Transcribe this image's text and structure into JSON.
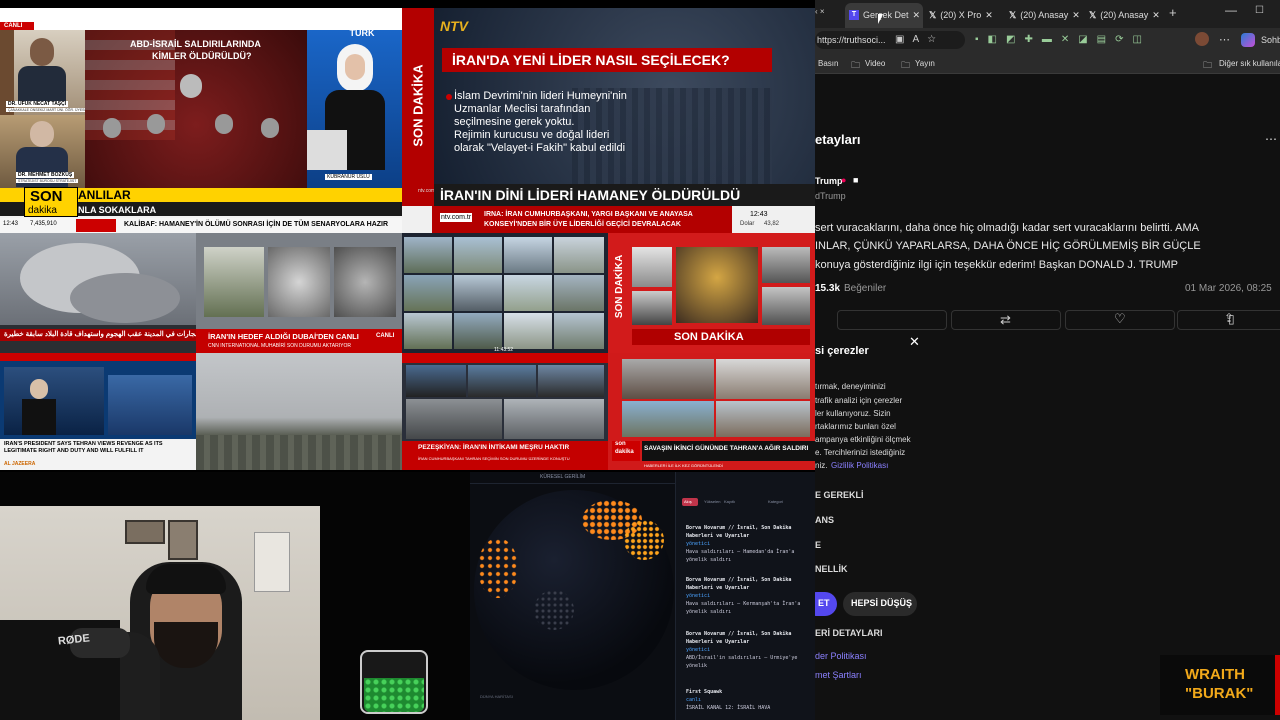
{
  "haberturk": {
    "live_badge": "CANLI",
    "headline_l1": "ABD-İSRAİL SALDIRILARINDA",
    "headline_l2": "KİMLER ÖLDÜRÜLDÜ?",
    "guest1_name": "DR. UFUK NECAT TAŞÇI",
    "guest1_title": "ÇANAKKALE ONSEKİZ MART ÜNİ. ÖĞR. ÜYESİ",
    "guest2_name": "DR. MEHMET BOZKUŞ",
    "guest2_title": "STRATEJİST BÜROSU STRATEJİST",
    "anchor_name": "KÜBRANUR USLU",
    "logo": "HABER TÜRK",
    "son": "SON",
    "dakika": "dakika",
    "banner1": "ANLILAR",
    "banner2": "NLA SOKAKLARA",
    "ticker_time": "12:43",
    "ticker_num": "7,435,910",
    "ticker_text": "KALİBAF: HAMANEY'İN ÖLÜMÜ SONRASI İÇİN DE TÜM SENARYOLARA HAZIR"
  },
  "ntv": {
    "logo": "NTV",
    "side": "SON DAKİKA",
    "headline": "İRAN'DA YENİ LİDER NASIL SEÇİLECEK?",
    "body_l1": "İslam Devrimi'nin lideri Humeyni'nin",
    "body_l2": "Uzmanlar Meclisi tarafından",
    "body_l3": "seçilmesine gerek yoktu.",
    "body_l4": "Rejimin kurucusu ve doğal lideri",
    "body_l5": "olarak \"Velayet-i Fakih\" kabul edildi",
    "small_logo": "ntv.com.tr",
    "banner": "İRAN'IN DİNİ LİDERİ HAMANEY ÖLDÜRÜLDÜ",
    "site": "ntv.com.tr",
    "ticker_l1": "IRNA: İRAN CUMHURBAŞKANI, YARGI BAŞKANI VE ANAYASA",
    "ticker_l2": "KONSEYİ'NDEN BİR ÜYE LİDERLİĞİ GEÇİCİ DEVRALACAK",
    "time": "12:43",
    "dolar_label": "Dolar",
    "dolar_value": "43,82"
  },
  "grid": {
    "arabic_ticker": "انفجارات في المدينة عقب الهجوم واستهداف قادة البلاد سابقة خطيرة",
    "live_title": "İRAN'IN HEDEF ALDIĞI DUBAİ'DEN CANLI",
    "live_sub": "CNN INTERNATIONAL MUHABİRİ SON DURUMU AKTARIYOR",
    "live_badge": "CANLI",
    "cam_time": "11:43:52",
    "son_dakika_side": "SON DAKİKA",
    "son_dakika_bar": "SON DAKİKA",
    "iran_caption": "IRAN'S PRESIDENT SAYS TEHRAN VIEWS REVENGE AS ITS LEGITIMATE RIGHT AND DUTY AND WILL FULFILL IT",
    "aljazeera": "AL JAZEERA",
    "pezeskiyan": "PEZEŞKİYAN: İRAN'IN İNTİKAMI MEŞRU HAKTIR",
    "pezeskiyan_sub": "İRAN CUMHURBAŞKANI TAHRAN SEÇİMİN SON DURUMU ÜZERİNDE KONUŞTU",
    "ikinci_gun": "SAVAŞIN İKİNCİ GÜNÜNDE TAHRAN'A AĞIR SALDIRI",
    "son": "son",
    "dakika": "dakika",
    "caption_small": "HABERLERİ İLE İLK KEZ GÖRÜNTÜLENDİ"
  },
  "streamer": {
    "mic_brand": "RØDE",
    "logo_l1": "WRAITH",
    "logo_l2": "\"BURAK\""
  },
  "globe": {
    "header": "KÜRESEL GERİLİM",
    "footer": "DÜNYA HARİTASI",
    "chat_tabs": [
      "Akış",
      "Yükselen",
      "Kayıtlı",
      "Kategori"
    ],
    "chat": [
      {
        "user": "Borva Novarum // İsrail, Son Dakika Haberleri ve Uyarılar",
        "tag": "yönetici",
        "body": "Hava saldırıları — Hamedan'da İran'a yönelik saldırı"
      },
      {
        "user": "Borva Novarum // İsrail, Son Dakika Haberleri ve Uyarılar",
        "tag": "yönetici",
        "body": "Hava saldırıları — Kermanşah'ta İran'a yönelik saldırı"
      },
      {
        "user": "Borva Novarum // İsrail, Son Dakika Haberleri ve Uyarılar",
        "tag": "yönetici",
        "body": "ABD/İsrail'in saldırıları — Urmiye'ye yönelik"
      },
      {
        "user": "First Squawk",
        "tag": "canlı",
        "body": "İSRAİL KANAL 12: İSRAİL HAVA"
      }
    ]
  },
  "browser": {
    "tabs": [
      {
        "label": "Gerçek Det"
      },
      {
        "label": "(20) X Pro"
      },
      {
        "label": "(20) Anasay"
      },
      {
        "label": "(20) Anasay"
      }
    ],
    "url": "https://truthsoci...",
    "bookmarks": [
      "Basın",
      "Video",
      "Yayın"
    ],
    "other_bookmarks": "Diğer sık kullanılanlar",
    "page_title": "etayları",
    "author": "Trump",
    "handle": "dTrump",
    "post_l1": "sert vuracaklarını, daha önce hiç olmadığı kadar sert vuracaklarını belirtti. AMA",
    "post_l2": "INLAR, ÇÜNKÜ YAPARLARSA, DAHA ÖNCE HİÇ GÖRÜLMEMİŞ BİR GÜÇLE",
    "post_l3": "konuya gösterdiğiniz ilgi için teşekkür ederim! Başkan DONALD J. TRUMP",
    "likes_count": "15.3k",
    "likes_label": "Beğeniler",
    "date": "01 Mar 2026, 08:25",
    "cookie_title": "si çerezler",
    "cookie_l1": "tırmak, deneyiminizi",
    "cookie_l2": "trafik analizi için çerezler",
    "cookie_l3": "ler kullanıyoruz. Sizin",
    "cookie_l4": "rtaklarımız bunları özel",
    "cookie_l5": "ampanya etkinliğini ölçmek",
    "cookie_l6": "e. Tercihlerinizi istediğiniz",
    "cookie_l7": "niz.",
    "privacy_link": "Gizlilik Politikası",
    "opt1": "E GEREKLİ",
    "opt2": "ANS",
    "opt3": "E",
    "opt4": "NELLİK",
    "btn_accept": "ET",
    "btn_deny": "HEPSİ DÜŞÜŞ",
    "details": "ERİ DETAYLARI",
    "policy": "der Politikası",
    "terms": "met Şartları"
  }
}
